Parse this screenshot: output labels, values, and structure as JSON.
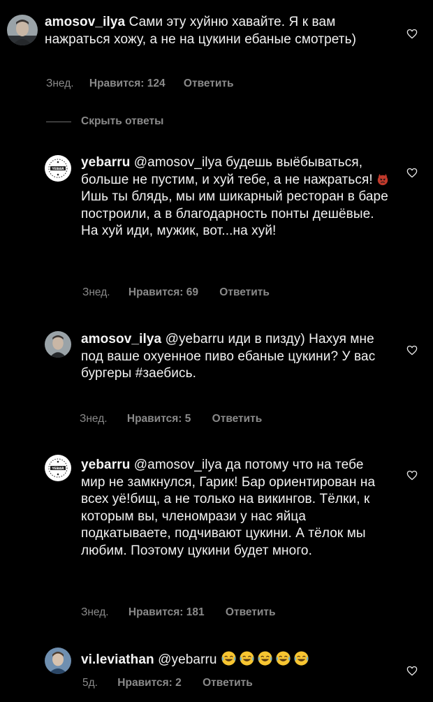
{
  "comments": [
    {
      "username": "amosov_ilya",
      "mention": "",
      "text": "Сами эту хуйню хавайте. Я к вам нажраться хожу, а не на цукини ебаные смотреть)",
      "time": "Знед.",
      "likes": "Нравится: 124",
      "reply": "Ответить"
    },
    {
      "username": "yebarru",
      "mention": "@amosov_ilya",
      "text": "будешь выёбываться, больше не пустим, и хуй тебе, а не нажраться!",
      "text_after_emoji": "Ишь ты блядь, мы им шикарный ресторан в баре построили, а в благодарность понты дешёвые. На хуй иди, мужик, вот...на хуй!",
      "time": "Знед.",
      "likes": "Нравится: 69",
      "reply": "Ответить"
    },
    {
      "username": "amosov_ilya",
      "mention": "@yebarru",
      "text": "иди в пизду) Нахуя мне под ваше охуенное пиво ебаные цукини? У вас бургеры #заебись.",
      "time": "Знед.",
      "likes": "Нравится: 5",
      "reply": "Ответить"
    },
    {
      "username": "yebarru",
      "mention": "@amosov_ilya",
      "text": "да потому что на тебе мир не замкнулся, Гарик! Бар ориентирован на всех уё!бищ, а не только на викингов. Тёлки, к которым вы, членомрази у нас яйца подкатываете, подчивают цукини. А тёлок мы любим. Поэтому цукини будет много.",
      "time": "Знед.",
      "likes": "Нравится: 181",
      "reply": "Ответить"
    },
    {
      "username": "vi.leviathan",
      "mention": "@yebarru",
      "text": "",
      "emoji_count": 5,
      "time": "5д.",
      "likes": "Нравится: 2",
      "reply": "Ответить"
    }
  ],
  "hide_replies_label": "Скрыть ответы",
  "avatar_badge_text": "YEBAR",
  "icons": {
    "like": "heart-outline-icon",
    "laugh": "face-with-tears-of-joy-icon",
    "devil": "angry-devil-icon"
  },
  "colors": {
    "background": "#000000",
    "text": "#f2f2f2",
    "meta": "#8a8a8a"
  }
}
